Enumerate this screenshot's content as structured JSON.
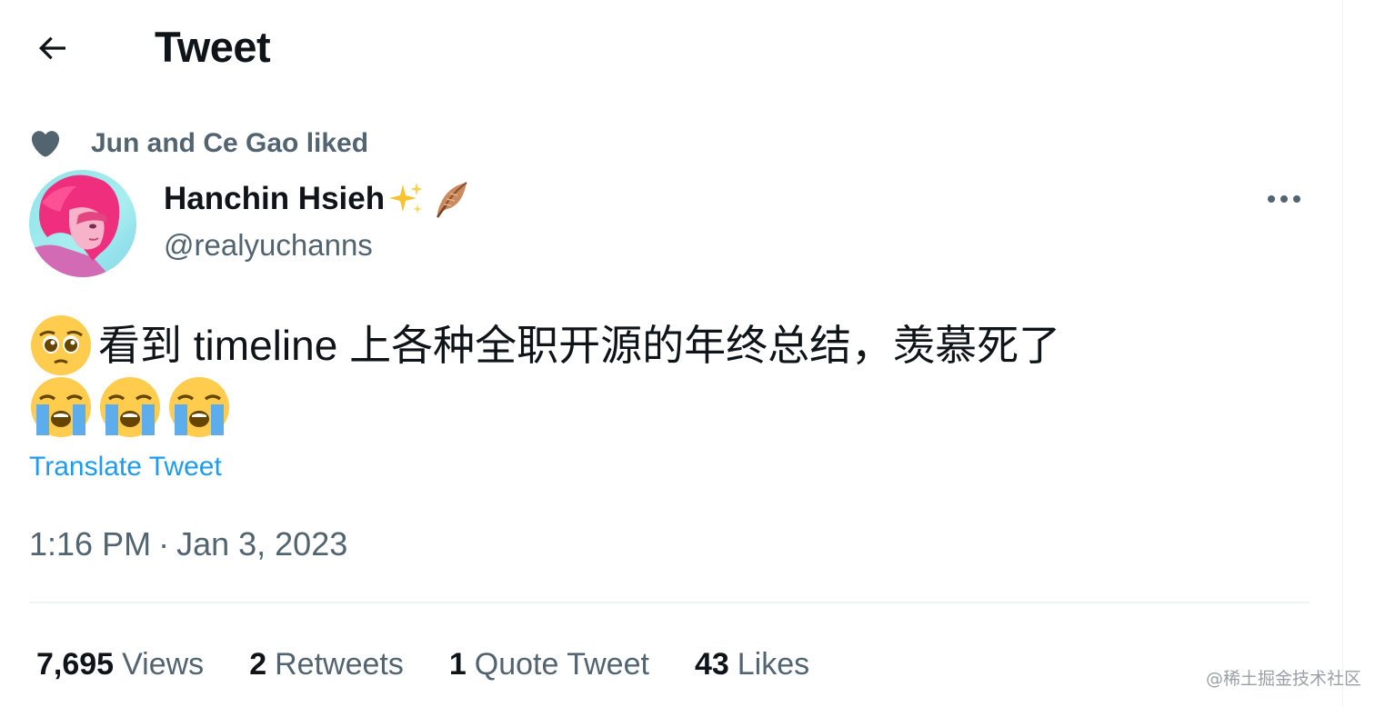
{
  "header": {
    "title": "Tweet",
    "back_icon": "arrow-left-icon"
  },
  "social_context": {
    "icon": "heart-icon",
    "text": "Jun and Ce Gao liked"
  },
  "author": {
    "name": "Hanchin Hsieh",
    "name_emojis": [
      "sparkles-icon",
      "feather-icon"
    ],
    "handle": "@realyuchanns",
    "avatar": "avatar-pink-hair-illustration"
  },
  "more_icon": "more-horizontal-icon",
  "tweet": {
    "text": "看到 timeline 上各种全职开源的年终总结，羡慕死了",
    "leading_emoji": "pleading-face-emoji",
    "trailing_emojis": [
      "loudly-crying-face-emoji",
      "loudly-crying-face-emoji",
      "loudly-crying-face-emoji"
    ],
    "translate": "Translate Tweet"
  },
  "timestamp": {
    "time": "1:16 PM",
    "separator": "·",
    "date": "Jan 3, 2023"
  },
  "stats": [
    {
      "count": "7,695",
      "label": "Views"
    },
    {
      "count": "2",
      "label": "Retweets"
    },
    {
      "count": "1",
      "label": "Quote Tweet"
    },
    {
      "count": "43",
      "label": "Likes"
    }
  ],
  "watermark": "@稀土掘金技术社区",
  "colors": {
    "text": "#0f1419",
    "secondary": "#536471",
    "link": "#1d9bf0",
    "divider": "#eff3f4"
  }
}
